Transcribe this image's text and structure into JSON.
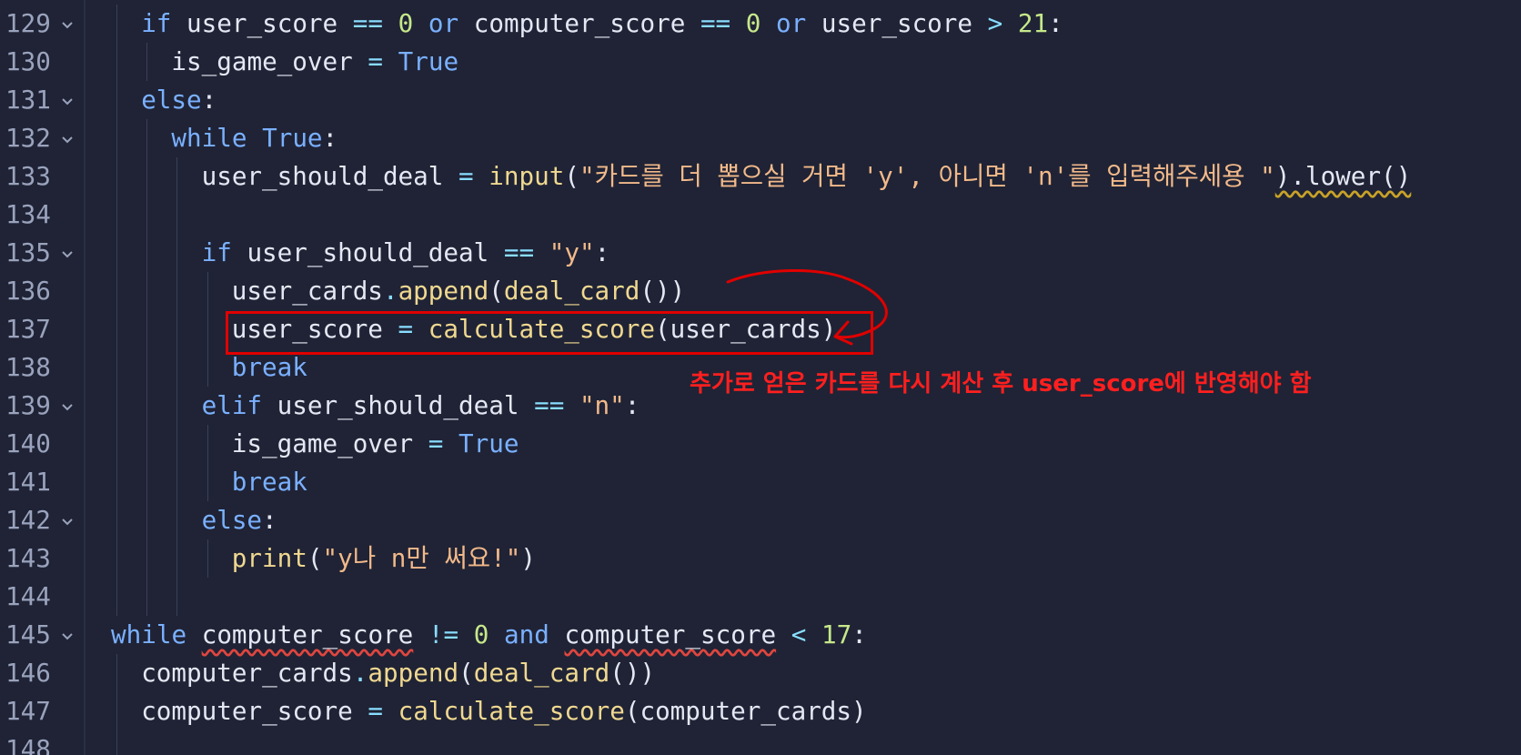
{
  "editor": {
    "lines": [
      {
        "number": "129",
        "fold": true,
        "indent": 1,
        "tokens": [
          [
            "kw",
            "if"
          ],
          [
            "t",
            " user_score "
          ],
          [
            "op",
            "=="
          ],
          [
            "t",
            " "
          ],
          [
            "num",
            "0"
          ],
          [
            "t",
            " "
          ],
          [
            "kw",
            "or"
          ],
          [
            "t",
            " computer_score "
          ],
          [
            "op",
            "=="
          ],
          [
            "t",
            " "
          ],
          [
            "num",
            "0"
          ],
          [
            "t",
            " "
          ],
          [
            "kw",
            "or"
          ],
          [
            "t",
            " user_score "
          ],
          [
            "op",
            ">"
          ],
          [
            "t",
            " "
          ],
          [
            "num",
            "21"
          ],
          [
            "t",
            ":"
          ]
        ]
      },
      {
        "number": "130",
        "fold": false,
        "indent": 2,
        "tokens": [
          [
            "t",
            "is_game_over "
          ],
          [
            "op",
            "="
          ],
          [
            "t",
            " "
          ],
          [
            "kw",
            "True"
          ]
        ]
      },
      {
        "number": "131",
        "fold": true,
        "indent": 1,
        "tokens": [
          [
            "kw",
            "else"
          ],
          [
            "t",
            ":"
          ]
        ]
      },
      {
        "number": "132",
        "fold": true,
        "indent": 2,
        "tokens": [
          [
            "kw",
            "while"
          ],
          [
            "t",
            " "
          ],
          [
            "kw",
            "True"
          ],
          [
            "t",
            ":"
          ]
        ]
      },
      {
        "number": "133",
        "fold": false,
        "indent": 3,
        "tokens": [
          [
            "t",
            "user_should_deal "
          ],
          [
            "op",
            "="
          ],
          [
            "t",
            " "
          ],
          [
            "fn",
            "input"
          ],
          [
            "t",
            "("
          ],
          [
            "str",
            "\"카드를 더 뽑으실 거면 'y', 아니면 'n'를 입력해주세용 \""
          ],
          [
            "sqy",
            ").lower()"
          ]
        ]
      },
      {
        "number": "134",
        "fold": false,
        "indent": 3,
        "tokens": []
      },
      {
        "number": "135",
        "fold": true,
        "indent": 3,
        "tokens": [
          [
            "kw",
            "if"
          ],
          [
            "t",
            " user_should_deal "
          ],
          [
            "op",
            "=="
          ],
          [
            "t",
            " "
          ],
          [
            "str",
            "\"y\""
          ],
          [
            "t",
            ":"
          ]
        ]
      },
      {
        "number": "136",
        "fold": false,
        "indent": 4,
        "tokens": [
          [
            "t",
            "user_cards"
          ],
          [
            "op",
            "."
          ],
          [
            "fn",
            "append"
          ],
          [
            "t",
            "("
          ],
          [
            "fn",
            "deal_card"
          ],
          [
            "t",
            "())"
          ]
        ]
      },
      {
        "number": "137",
        "fold": false,
        "indent": 4,
        "tokens": [
          [
            "t",
            "user_score "
          ],
          [
            "op",
            "="
          ],
          [
            "t",
            " "
          ],
          [
            "fn",
            "calculate_score"
          ],
          [
            "t",
            "(user_cards)"
          ]
        ]
      },
      {
        "number": "138",
        "fold": false,
        "indent": 4,
        "tokens": [
          [
            "kw",
            "break"
          ]
        ]
      },
      {
        "number": "139",
        "fold": true,
        "indent": 3,
        "tokens": [
          [
            "kw",
            "elif"
          ],
          [
            "t",
            " user_should_deal "
          ],
          [
            "op",
            "=="
          ],
          [
            "t",
            " "
          ],
          [
            "str",
            "\"n\""
          ],
          [
            "t",
            ":"
          ]
        ]
      },
      {
        "number": "140",
        "fold": false,
        "indent": 4,
        "tokens": [
          [
            "t",
            "is_game_over "
          ],
          [
            "op",
            "="
          ],
          [
            "t",
            " "
          ],
          [
            "kw",
            "True"
          ]
        ]
      },
      {
        "number": "141",
        "fold": false,
        "indent": 4,
        "tokens": [
          [
            "kw",
            "break"
          ]
        ]
      },
      {
        "number": "142",
        "fold": true,
        "indent": 3,
        "tokens": [
          [
            "kw",
            "else"
          ],
          [
            "t",
            ":"
          ]
        ]
      },
      {
        "number": "143",
        "fold": false,
        "indent": 4,
        "tokens": [
          [
            "fn",
            "print"
          ],
          [
            "t",
            "("
          ],
          [
            "str",
            "\"y나 n만 써요!\""
          ],
          [
            "t",
            ")"
          ]
        ]
      },
      {
        "number": "144",
        "fold": false,
        "indent": 3,
        "tokens": []
      },
      {
        "number": "145",
        "fold": true,
        "indent": 0,
        "tokens": [
          [
            "kw",
            "while"
          ],
          [
            "t",
            " "
          ],
          [
            "sqr",
            "computer_score"
          ],
          [
            "t",
            " "
          ],
          [
            "op",
            "!="
          ],
          [
            "t",
            " "
          ],
          [
            "num",
            "0"
          ],
          [
            "t",
            " "
          ],
          [
            "kw",
            "and"
          ],
          [
            "t",
            " "
          ],
          [
            "sqr",
            "computer_score"
          ],
          [
            "t",
            " "
          ],
          [
            "op",
            "<"
          ],
          [
            "t",
            " "
          ],
          [
            "num",
            "17"
          ],
          [
            "t",
            ":"
          ]
        ]
      },
      {
        "number": "146",
        "fold": false,
        "indent": 1,
        "tokens": [
          [
            "t",
            "computer_cards"
          ],
          [
            "op",
            "."
          ],
          [
            "fn",
            "append"
          ],
          [
            "t",
            "("
          ],
          [
            "fn",
            "deal_card"
          ],
          [
            "t",
            "())"
          ]
        ]
      },
      {
        "number": "147",
        "fold": false,
        "indent": 1,
        "tokens": [
          [
            "t",
            "computer_score "
          ],
          [
            "op",
            "="
          ],
          [
            "t",
            " "
          ],
          [
            "fn",
            "calculate_score"
          ],
          [
            "t",
            "(computer_cards)"
          ]
        ]
      },
      {
        "number": "148",
        "fold": false,
        "indent": 1,
        "tokens": []
      }
    ]
  },
  "annotation": {
    "text": "추가로 얻은 카드를 다시 계산 후 user_score에 반영해야 함",
    "color": "#ff1f1f"
  },
  "colors": {
    "background": "#1f2335",
    "keyword": "#7ab0ff",
    "number": "#c6e88a",
    "function": "#f0d890",
    "string": "#f2b98a",
    "highlight_box": "#e00000"
  }
}
